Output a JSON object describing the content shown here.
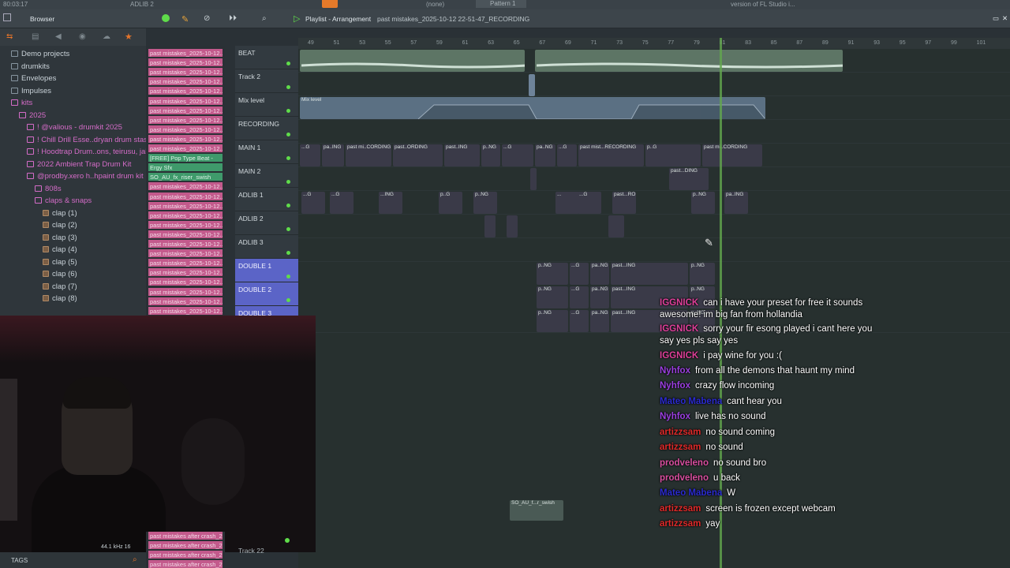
{
  "topbar": {
    "time": "80:03:17",
    "adlib_label": "ADLIB 2",
    "pattern": "Pattern 1",
    "preset": "(none)",
    "version_text": "version of FL Studio i..."
  },
  "browser": {
    "title": "Browser",
    "items": [
      {
        "label": "Demo projects",
        "style": "folder"
      },
      {
        "label": "drumkits",
        "style": "folder"
      },
      {
        "label": "Envelopes",
        "style": "folder"
      },
      {
        "label": "Impulses",
        "style": "folder"
      },
      {
        "label": "kits",
        "style": "pink"
      },
      {
        "label": "2025",
        "style": "pink"
      },
      {
        "label": "! @valious - drumkit 2025",
        "style": "pink"
      },
      {
        "label": "! Chill Drill Esse..dryan drum stash",
        "style": "pink"
      },
      {
        "label": "! Hoodtrap Drum..ons, teirusu, jal)",
        "style": "pink"
      },
      {
        "label": "2022 Ambient Trap Drum Kit",
        "style": "pink"
      },
      {
        "label": "@prodby.xero h..hpaint drum kit",
        "style": "pink"
      },
      {
        "label": "808s",
        "style": "pink"
      },
      {
        "label": "claps & snaps",
        "style": "pink"
      },
      {
        "label": "clap (1)",
        "style": "file"
      },
      {
        "label": "clap (2)",
        "style": "file"
      },
      {
        "label": "clap (3)",
        "style": "file"
      },
      {
        "label": "clap (4)",
        "style": "file"
      },
      {
        "label": "clap (5)",
        "style": "file"
      },
      {
        "label": "clap (6)",
        "style": "file"
      },
      {
        "label": "clap (7)",
        "style": "file"
      },
      {
        "label": "clap (8)",
        "style": "file"
      }
    ],
    "tags_label": "TAGS",
    "sample_rate": "44.1 kHz 16"
  },
  "patterns": {
    "items": [
      "past mistakes_2025-10-12...",
      "past mistakes_2025-10-12...",
      "past mistakes_2025-10-12...",
      "past mistakes_2025-10-12...",
      "past mistakes_2025-10-12...",
      "past mistakes_2025-10-12...",
      "past mistakes_2025-10-12...",
      "past mistakes_2025-10-12...",
      "past mistakes_2025-10-12...",
      "past mistakes_2025-10-12...",
      "past mistakes_2025-10-12...",
      "[FREE] Pop Type Beat -",
      "Ergy Sfx",
      "SO_AU_fx_riser_swish",
      "past mistakes_2025-10-12...",
      "past mistakes_2025-10-12...",
      "past mistakes_2025-10-12...",
      "past mistakes_2025-10-12...",
      "past mistakes_2025-10-12...",
      "past mistakes_2025-10-12...",
      "past mistakes_2025-10-12...",
      "past mistakes_2025-10-12...",
      "past mistakes_2025-10-12...",
      "past mistakes_2025-10-12...",
      "past mistakes_2025-10-12...",
      "past mistakes_2025-10-12...",
      "past mistakes_2025-10-12...",
      "past mistakes_2025-10-12..."
    ],
    "bottom": [
      "past mistakes after crash_2...",
      "past mistakes after crash_2...",
      "past mistakes after crash_2...",
      "past mistakes after crash_2..."
    ]
  },
  "playlist": {
    "title": "Playlist - Arrangement",
    "project": "past mistakes_2025-10-12 22-51-47_RECORDING"
  },
  "ruler": [
    "49",
    "51",
    "53",
    "55",
    "57",
    "59",
    "61",
    "63",
    "65",
    "67",
    "69",
    "71",
    "73",
    "75",
    "77",
    "79",
    "81",
    "83",
    "85",
    "87",
    "89",
    "91",
    "93",
    "95",
    "97",
    "99",
    "101"
  ],
  "tracks": [
    {
      "name": "BEAT",
      "style": "plain"
    },
    {
      "name": "Track 2",
      "style": "plain"
    },
    {
      "name": "Mix level",
      "style": "plain"
    },
    {
      "name": "RECORDING",
      "style": "plain"
    },
    {
      "name": "MAIN 1",
      "style": "plain"
    },
    {
      "name": "MAIN 2",
      "style": "plain"
    },
    {
      "name": "ADLIB 1",
      "style": "plain"
    },
    {
      "name": "ADLIB 2",
      "style": "plain"
    },
    {
      "name": "ADLIB 3",
      "style": "plain"
    },
    {
      "name": "DOUBLE 1",
      "style": "blue"
    },
    {
      "name": "DOUBLE 2",
      "style": "blue"
    },
    {
      "name": "DOUBLE 3",
      "style": "blue"
    }
  ],
  "track22": "Track 22",
  "clips": {
    "mix_level": "Mix level",
    "main1": [
      "...G",
      "pa..ING",
      "past mi..CORDING",
      "past..ORDING",
      "past..ING",
      "p..NG",
      "...G",
      "pa..NG",
      "...G",
      "past mist...RECORDING",
      "p..G",
      "past mi..CORDING"
    ],
    "main2": "past...DING",
    "adlib1": [
      "...G",
      "...G",
      "...ING",
      "p..G",
      "p..NG",
      "...",
      "...G",
      "past...ROING",
      "p..NG",
      "pa..ING"
    ],
    "double": [
      "p..NG",
      "...G",
      "pa..NG",
      "past...ING",
      "p..NG"
    ],
    "swish": "SO_AU_f...r_swish"
  },
  "chat": [
    {
      "user": "IGGNICK",
      "text": "can i have your preset for free it sounds",
      "cls": "u-iggnick"
    },
    {
      "user": "",
      "text": "awesome! im big fan from hollandia",
      "cls": ""
    },
    {
      "user": "IGGNICK",
      "text": "sorry your fir esong played i cant here you",
      "cls": "u-iggnick"
    },
    {
      "user": "",
      "text": "say yes pls say yes",
      "cls": ""
    },
    {
      "user": "IGGNICK",
      "text": "i pay wine for you :(",
      "cls": "u-iggnick"
    },
    {
      "user": "Nyhfox",
      "text": "from all the demons that haunt my mind",
      "cls": "u-nyhfox"
    },
    {
      "user": "Nyhfox",
      "text": "crazy flow incoming",
      "cls": "u-nyhfox"
    },
    {
      "user": "Mateo Mabena",
      "text": "cant hear you",
      "cls": "u-mateo"
    },
    {
      "user": "Nyhfox",
      "text": "live has no sound",
      "cls": "u-nyhfox"
    },
    {
      "user": "artizzsam",
      "text": "no sound coming",
      "cls": "u-artiz"
    },
    {
      "user": "artizzsam",
      "text": "no sound",
      "cls": "u-artiz"
    },
    {
      "user": "prodveleno",
      "text": "no sound bro",
      "cls": "u-prod"
    },
    {
      "user": "prodveleno",
      "text": "u back",
      "cls": "u-prod"
    },
    {
      "user": "Mateo Mabena",
      "text": "W",
      "cls": "u-mateo"
    },
    {
      "user": "artizzsam",
      "text": "screen is frozen except webcam",
      "cls": "u-artiz"
    },
    {
      "user": "artizzsam",
      "text": "yay",
      "cls": "u-artiz"
    }
  ],
  "colors": {
    "playhead": "#63a84d",
    "pattern_pink": "#c35a8c",
    "track_blue": "#5b64c7"
  }
}
